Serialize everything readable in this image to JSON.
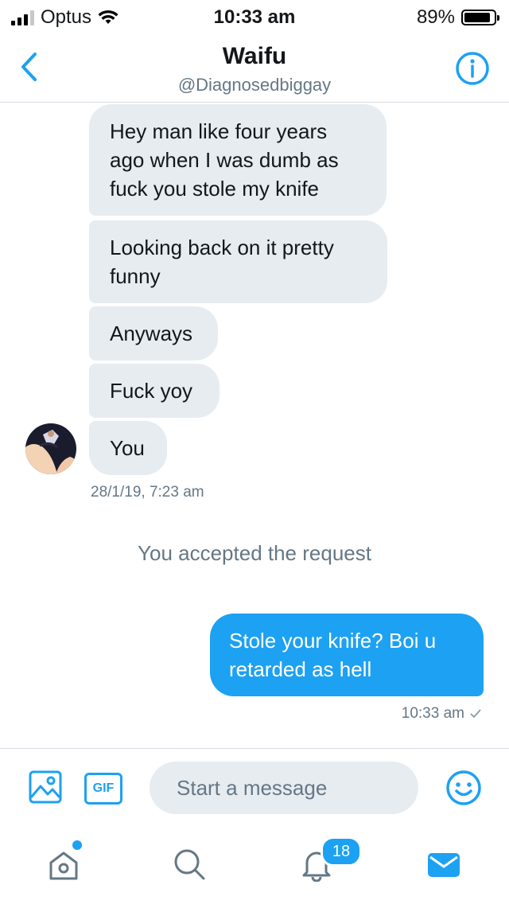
{
  "status_bar": {
    "carrier": "Optus",
    "time": "10:33 am",
    "battery_percent": "89%",
    "battery_level": 0.89,
    "signal_bars": 3
  },
  "header": {
    "title": "Waifu",
    "handle": "@Diagnosedbiggay",
    "back_icon": "chevron-left-icon",
    "info_icon": "info-icon"
  },
  "messages": {
    "incoming": [
      "Hey man like four years ago when I was dumb as fuck you stole my knife",
      "Looking back on it pretty funny",
      "Anyways",
      "Fuck yoy",
      "You"
    ],
    "incoming_timestamp": "28/1/19, 7:23 am",
    "system_notice": "You accepted the request",
    "outgoing": "Stole your knife? Boi u retarded as hell",
    "outgoing_timestamp": "10:33 am",
    "outgoing_status_icon": "checkmark-icon"
  },
  "composer": {
    "placeholder": "Start a message",
    "gif_label": "GIF",
    "media_icon": "image-icon",
    "emoji_icon": "emoji-icon"
  },
  "tab_bar": {
    "home_icon": "home-icon",
    "search_icon": "search-icon",
    "notifications_icon": "bell-icon",
    "notifications_badge": "18",
    "messages_icon": "mail-icon"
  },
  "colors": {
    "accent": "#1da1f2",
    "incoming_bubble": "#e6ecf0",
    "secondary_text": "#657786"
  }
}
